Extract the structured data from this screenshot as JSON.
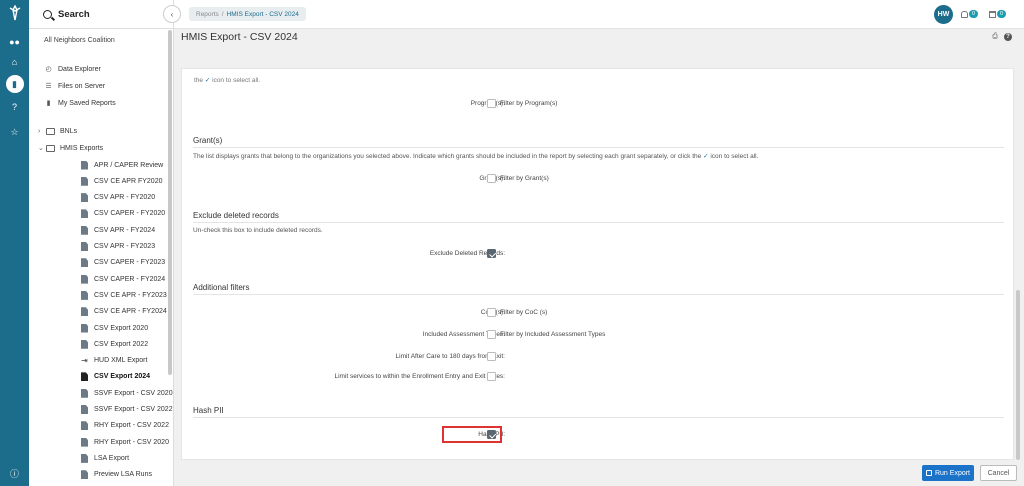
{
  "sidebar": {
    "search_label": "Search",
    "org": "All Neighbors Coalition",
    "top_items": [
      {
        "label": "Data Explorer",
        "icon": "gauge-icon"
      },
      {
        "label": "Files on Server",
        "icon": "list-icon"
      },
      {
        "label": "My Saved Reports",
        "icon": "document-icon"
      }
    ],
    "folders": [
      {
        "label": "BNLs",
        "expanded": false
      },
      {
        "label": "HMIS Exports",
        "expanded": true
      }
    ],
    "exports": [
      "APR / CAPER Review",
      "CSV CE APR FY2020",
      "CSV APR - FY2020",
      "CSV CAPER - FY2020",
      "CSV APR - FY2024",
      "CSV APR - FY2023",
      "CSV CAPER - FY2023",
      "CSV CAPER - FY2024",
      "CSV CE APR - FY2023",
      "CSV CE APR - FY2024",
      "CSV Export 2020",
      "CSV Export 2022",
      "HUD XML Export",
      "CSV Export 2024",
      "SSVF Export - CSV 2020",
      "SSVF Export - CSV 2022",
      "RHY Export - CSV 2022",
      "RHY Export - CSV 2020",
      "LSA Export",
      "Preview LSA Runs"
    ],
    "active_export": "CSV Export 2024"
  },
  "topbar": {
    "breadcrumb_root": "Reports",
    "breadcrumb_sep": "/",
    "breadcrumb_current": "HMIS Export - CSV 2024",
    "avatar_initials": "HW",
    "notifications_count": "0",
    "calendar_count": "0"
  },
  "page": {
    "title": "HMIS Export - CSV 2024"
  },
  "form": {
    "cut_text_prefix": "the",
    "cut_text_suffix": "icon to select all.",
    "programs": {
      "label": "Program(s):",
      "checkbox_text": "Filter by Program(s)",
      "checked": false
    },
    "grant_section": {
      "title": "Grant(s)",
      "desc_prefix": "The list displays grants that belong to the organizations you selected above. Indicate which grants should be included in the report by selecting each grant separately, or click the",
      "desc_suffix": "icon to select all.",
      "label": "Grant(s):",
      "checkbox_text": "Filter by Grant(s)",
      "checked": false
    },
    "deleted_section": {
      "title": "Exclude deleted records",
      "desc": "Un-check this box to include deleted records.",
      "label": "Exclude Deleted Records:",
      "checked": true
    },
    "additional_section": {
      "title": "Additional filters",
      "rows": [
        {
          "label": "CoC (s):",
          "checkbox_text": "Filter by CoC (s)",
          "checked": false
        },
        {
          "label": "Included Assessment Types:",
          "checkbox_text": "Filter by Included Assessment Types",
          "checked": false
        },
        {
          "label": "Limit After Care to 180 days from Exit:",
          "checkbox_text": "",
          "checked": false
        },
        {
          "label": "Limit services to within the Enrollment Entry and Exit dates:",
          "checkbox_text": "",
          "checked": false
        }
      ]
    },
    "hash_section": {
      "title": "Hash PII",
      "label": "Hash PII:",
      "checked": true
    }
  },
  "actions": {
    "run_label": "Run Export",
    "cancel_label": "Cancel"
  },
  "colors": {
    "rail": "#1c6c8c",
    "primary_button": "#1a73c9",
    "highlight": "#dd3333"
  }
}
